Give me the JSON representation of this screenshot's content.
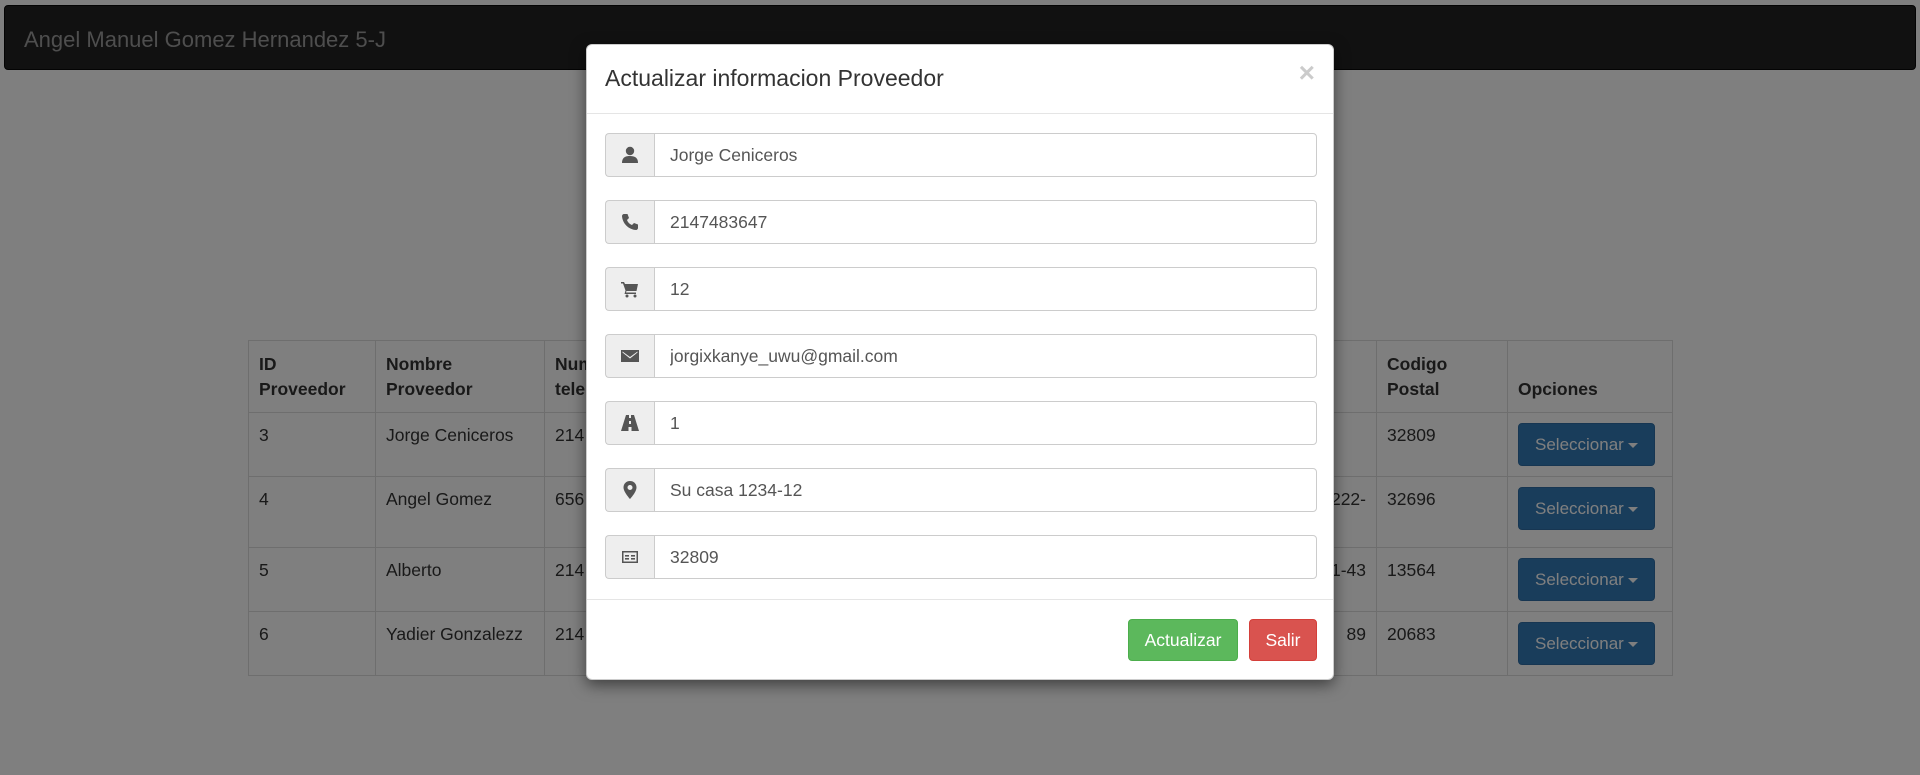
{
  "navbar": {
    "brand": "Angel Manuel Gomez Hernandez 5-J"
  },
  "table": {
    "headers": [
      "ID\nProveedor",
      "Nombre\nProveedor",
      "Num\ntele",
      "",
      "",
      "",
      "",
      "",
      "Codigo\nPostal",
      "Opciones"
    ],
    "header_visible": {
      "id": [
        "ID",
        "Proveedor"
      ],
      "nombre": [
        "Nombre",
        "Proveedor"
      ],
      "numtel": [
        "Num",
        "tele"
      ],
      "cp": [
        "Codigo",
        "Postal"
      ],
      "opciones": "Opciones"
    },
    "rows": [
      {
        "id": "3",
        "nombre": "Jorge Ceniceros",
        "tel": "214",
        "dir_frag": "",
        "cp": "32809",
        "btn": "Seleccionar"
      },
      {
        "id": "4",
        "nombre": "Angel Gomez",
        "tel": "656",
        "dir_frag": "222-",
        "cp": "32696",
        "btn": "Seleccionar"
      },
      {
        "id": "5",
        "nombre": "Alberto",
        "tel": "214",
        "dir_frag": "1-43",
        "cp": "13564",
        "btn": "Seleccionar"
      },
      {
        "id": "6",
        "nombre": "Yadier Gonzalezz",
        "tel": "214",
        "dir_frag": "89",
        "cp": "20683",
        "btn": "Seleccionar"
      }
    ]
  },
  "modal": {
    "title": "Actualizar informacion Proveedor",
    "close": "×",
    "fields": [
      {
        "icon": "user-icon",
        "value": "Jorge Ceniceros"
      },
      {
        "icon": "phone-icon",
        "value": "2147483647"
      },
      {
        "icon": "shopping-cart-icon",
        "value": "12"
      },
      {
        "icon": "envelope-icon",
        "value": "jorgixkanye_uwu@gmail.com"
      },
      {
        "icon": "road-icon",
        "value": "1"
      },
      {
        "icon": "map-marker-icon",
        "value": "Su casa 1234-12"
      },
      {
        "icon": "subtitles-icon",
        "value": "32809"
      }
    ],
    "buttons": {
      "update": "Actualizar",
      "exit": "Salir"
    }
  },
  "colors": {
    "navbar": "#222222",
    "primary": "#337ab7",
    "success": "#5cb85c",
    "danger": "#d9534f"
  }
}
